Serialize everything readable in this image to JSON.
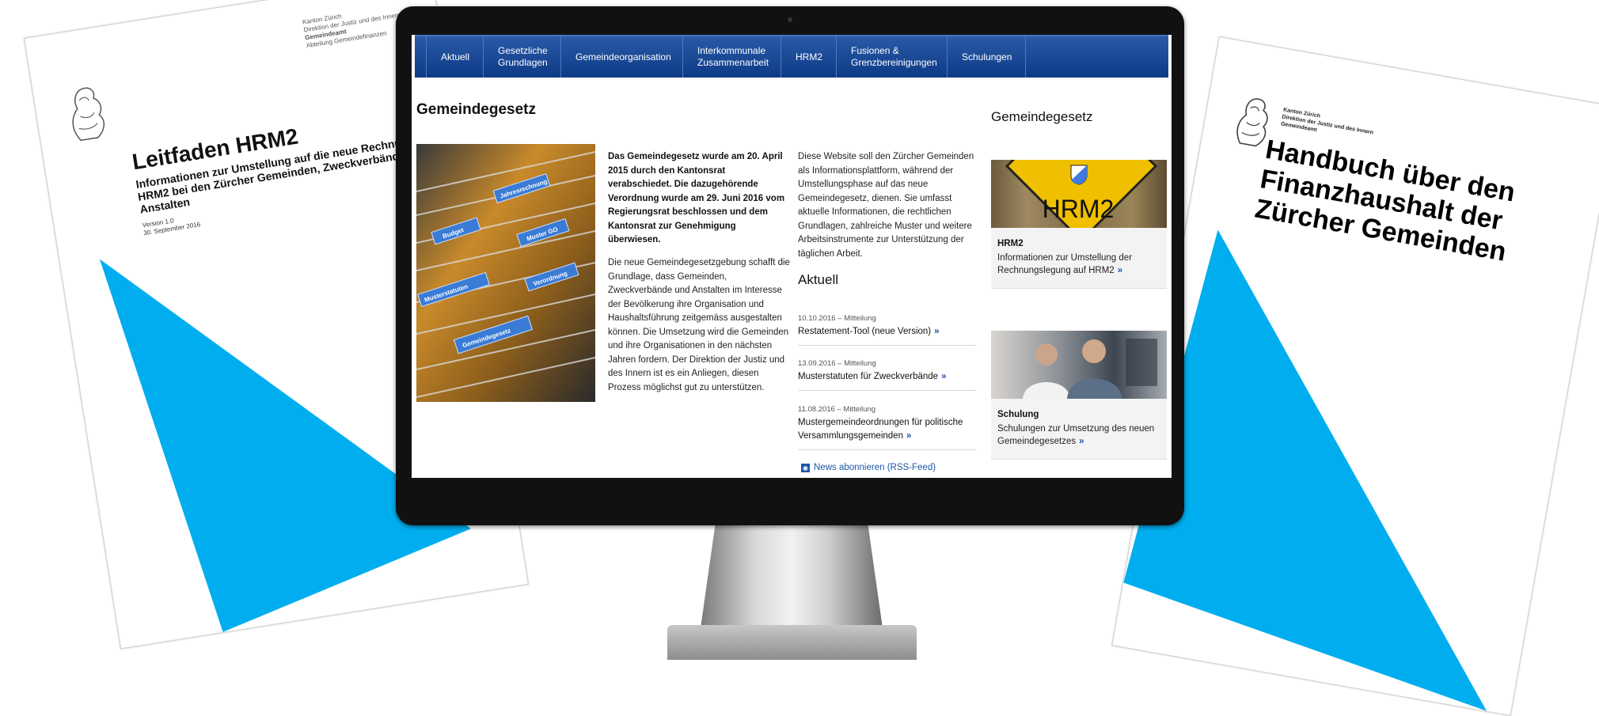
{
  "left_doc": {
    "address_lines": [
      "Kanton Zürich",
      "Direktion der Justiz und des Innern",
      "Gemeindeamt",
      "Abteilung Gemeindefinanzen"
    ],
    "title": "Leitfaden HRM2",
    "subtitle": "Informationen zur Umstellung auf die neue Rechnungsle­gung HRM2 bei den Zürcher Gemeinden, Zweckverbän­den und Anstalten",
    "meta_lines": [
      "Version 1.0",
      "30. September 2016"
    ]
  },
  "right_doc": {
    "address_lines": [
      "Kanton Zürich",
      "Direktion der Justiz und des Innern",
      "Gemeindeamt"
    ],
    "title": "Handbuch über den Finanzhaushalt der Zürcher Gemeinden"
  },
  "nav": {
    "items": [
      {
        "label": "Aktuell"
      },
      {
        "label": "Gesetzliche\nGrundlagen"
      },
      {
        "label": "Gemeindeorganisation"
      },
      {
        "label": "Interkommunale\nZusammenarbeit"
      },
      {
        "label": "HRM2"
      },
      {
        "label": "Fusionen &\nGrenzbereinigungen"
      },
      {
        "label": "Schulungen"
      }
    ]
  },
  "main": {
    "title": "Gemeindegesetz",
    "folder_tabs": [
      "Jahresrechnung",
      "Budget",
      "Muster GO",
      "Verordnung",
      "Musterstatuten",
      "Gemeindegesetz"
    ],
    "lead": "Das Gemeindegesetz wurde am 20. April 2015 durch den Kantonsrat verabschiedet. Die dazugehörende Verordnung wurde am 29. Juni 2016 vom Regierungsrat beschlossen und dem Kantonsrat zur Genehmigung überwiesen.",
    "body": "Die neue Gemeindegesetzgebung schafft die Grundlage, dass Gemeinden, Zweckverbände und Anstalten im Interesse der Bevölkerung ihre Organisation und Haushaltsführung zeitgemäss ausgestalten können. Die Umsetzung wird die Gemeinden und ihre Organisationen in den nächsten Jahren fordern. Der Direktion der Justiz und des Innern ist es ein Anliegen, diesen Prozess möglichst gut zu unterstützen.",
    "intro": "Diese Website soll den Zürcher Gemeinden als Informationsplattform, während der Umstellungsphase auf das neue Gemeindegesetz, dienen. Sie umfasst aktuelle Informationen, die rechtlichen Grundlagen, zahlreiche Muster und weitere Arbeitsinstrumente zur Unterstützung der täglichen Arbeit."
  },
  "aktuell": {
    "title": "Aktuell",
    "items": [
      {
        "date": "10.10.2016 – Mitteilung",
        "title": "Restatement-Tool (neue Version)"
      },
      {
        "date": "13.09.2016 – Mitteilung",
        "title": "Musterstatuten für Zweckverbände"
      },
      {
        "date": "11.08.2016 – Mitteilung",
        "title": "Mustergemeindeordnungen für politische Versammlungsgemeinden"
      }
    ],
    "rss_label": "News abonnieren (RSS-Feed)"
  },
  "sidebar": {
    "title": "Gemeindegesetz",
    "teasers": [
      {
        "image_text": "HRM2",
        "title": "HRM2",
        "text": "Informationen zur Umstellung der Rechnungslegung auf HRM2"
      },
      {
        "title": "Schulung",
        "text": "Schulungen zur Umsetzung des neuen Gemeindegesetzes"
      }
    ]
  },
  "colors": {
    "nav_blue": "#0d3a86",
    "link_blue": "#1b56a7",
    "triangle_blue": "#00aeef",
    "sign_yellow": "#f0c000"
  }
}
